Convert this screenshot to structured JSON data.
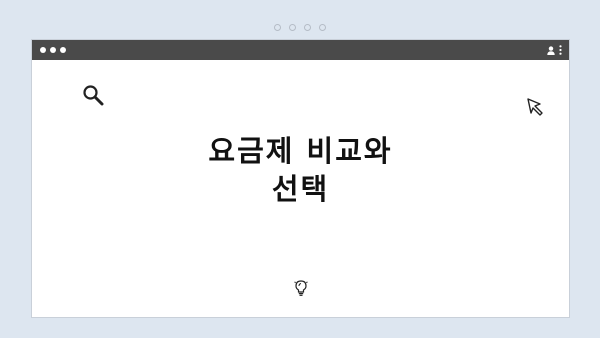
{
  "pager": {
    "count": 4
  },
  "window": {
    "titlebar": {
      "controls": [
        "close-light",
        "minimize-light",
        "maximize-light"
      ],
      "right_icons": [
        "user-icon",
        "kebab-menu-icon"
      ]
    },
    "main": {
      "title_line_1": "요금제 비교와",
      "title_line_2": "선택",
      "icons": [
        "search-icon",
        "cursor-arrow-icon",
        "lightbulb-icon"
      ]
    }
  },
  "colors": {
    "background": "#dde6f0",
    "titlebar": "#4a4a4a",
    "window": "#ffffff",
    "text": "#111111"
  }
}
